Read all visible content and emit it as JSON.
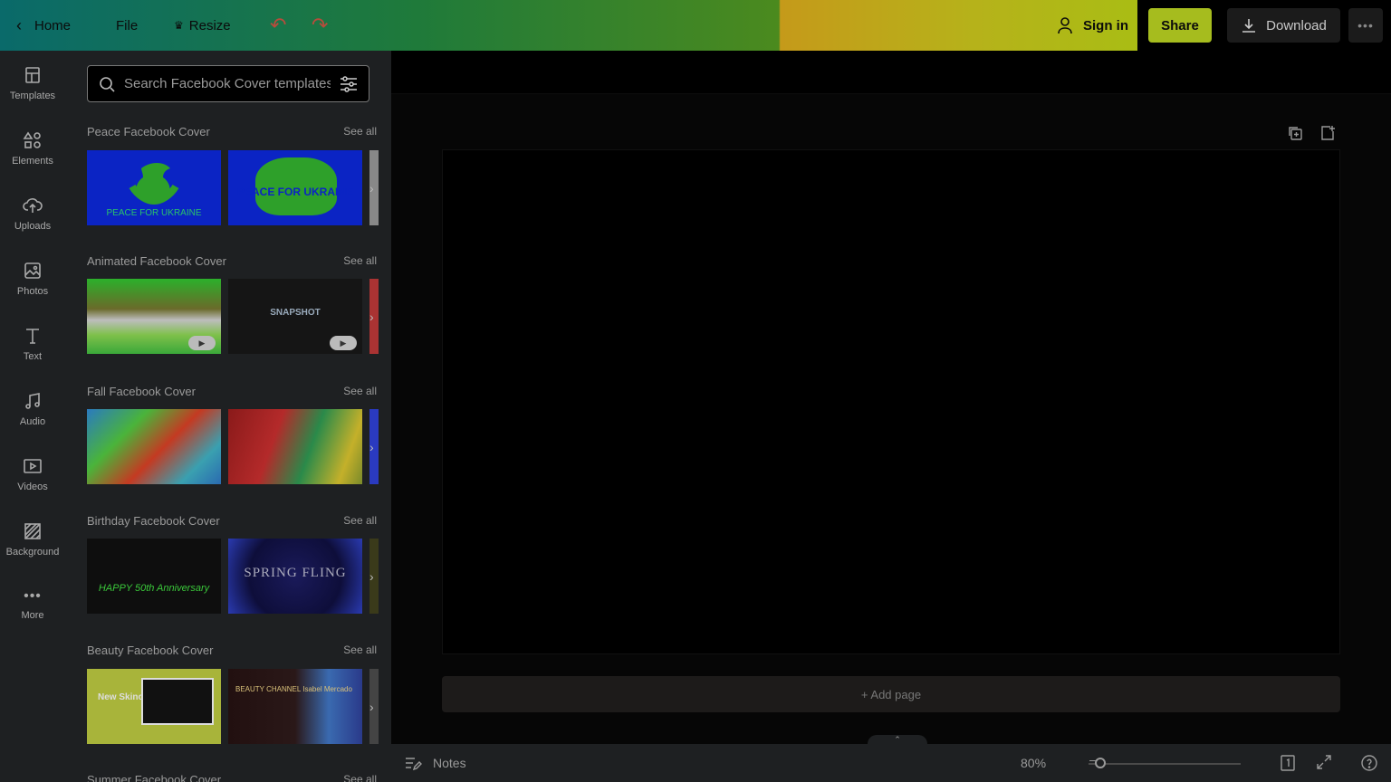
{
  "topbar": {
    "home_label": "Home",
    "file_label": "File",
    "resize_label": "Resize",
    "signin_label": "Sign in",
    "share_label": "Share",
    "download_label": "Download"
  },
  "rail": {
    "items": [
      {
        "label": "Templates",
        "icon": "templates-icon"
      },
      {
        "label": "Elements",
        "icon": "elements-icon"
      },
      {
        "label": "Uploads",
        "icon": "upload-icon"
      },
      {
        "label": "Photos",
        "icon": "photo-icon"
      },
      {
        "label": "Text",
        "icon": "text-icon"
      },
      {
        "label": "Audio",
        "icon": "audio-icon"
      },
      {
        "label": "Videos",
        "icon": "video-icon"
      },
      {
        "label": "Background",
        "icon": "background-icon"
      },
      {
        "label": "More",
        "icon": "more-icon"
      }
    ]
  },
  "panel": {
    "search_placeholder": "Search Facebook Cover templates",
    "sections": [
      {
        "title": "Peace Facebook Cover",
        "see_all": "See all",
        "thumb_captions": [
          "PEACE FOR UKRAINE",
          "PEACE FOR UKRAINE"
        ]
      },
      {
        "title": "Animated Facebook Cover",
        "see_all": "See all",
        "thumb_captions": [
          "",
          "SNAPSHOT"
        ]
      },
      {
        "title": "Fall Facebook Cover",
        "see_all": "See all",
        "thumb_captions": [
          "",
          ""
        ]
      },
      {
        "title": "Birthday Facebook Cover",
        "see_all": "See all",
        "thumb_captions": [
          "HAPPY 50th Anniversary",
          "SPRING FLING"
        ]
      },
      {
        "title": "Beauty Facebook Cover",
        "see_all": "See all",
        "thumb_captions": [
          "New Skincare Product",
          "BEAUTY CHANNEL Isabel Mercado"
        ]
      },
      {
        "title": "Summer Facebook Cover",
        "see_all": "See all",
        "thumb_captions": [
          "",
          ""
        ]
      }
    ]
  },
  "canvas": {
    "add_page_label": "+ Add page"
  },
  "bottombar": {
    "notes_label": "Notes",
    "zoom": "80%",
    "zoom_level": 0.08
  },
  "colors": {
    "accent_share": "#a6bc1e",
    "panel_bg": "#1e2022",
    "canvas_bg": "#000000"
  }
}
